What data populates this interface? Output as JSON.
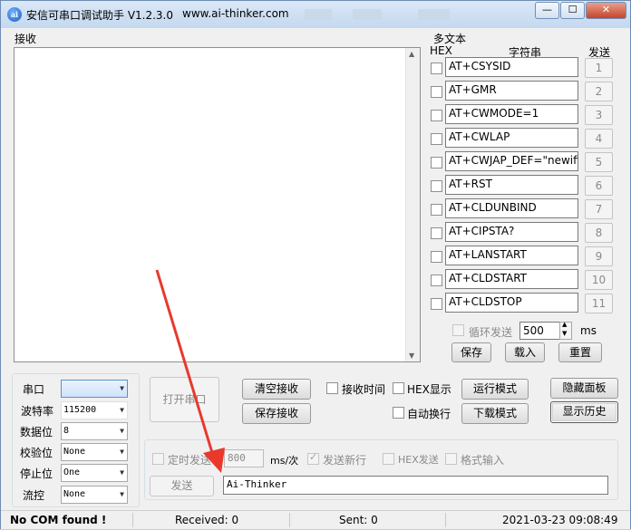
{
  "titlebar": {
    "title": "安信可串口调试助手 V1.2.3.0",
    "url": "www.ai-thinker.com",
    "minimize_glyph": "—",
    "maximize_glyph": "☐",
    "close_glyph": "✕"
  },
  "receive": {
    "label": "接收"
  },
  "multitext": {
    "label": "多文本",
    "col_hex": "HEX",
    "col_string": "字符串",
    "col_send": "发送",
    "rows": [
      {
        "text": "AT+CSYSID",
        "num": "1"
      },
      {
        "text": "AT+GMR",
        "num": "2"
      },
      {
        "text": "AT+CWMODE=1",
        "num": "3"
      },
      {
        "text": "AT+CWLAP",
        "num": "4"
      },
      {
        "text": "AT+CWJAP_DEF=\"newifi_",
        "num": "5"
      },
      {
        "text": "AT+RST",
        "num": "6"
      },
      {
        "text": "AT+CLDUNBIND",
        "num": "7"
      },
      {
        "text": "AT+CIPSTA?",
        "num": "8"
      },
      {
        "text": "AT+LANSTART",
        "num": "9"
      },
      {
        "text": "AT+CLDSTART",
        "num": "10"
      },
      {
        "text": "AT+CLDSTOP",
        "num": "11"
      }
    ],
    "loop_label": "循环发送",
    "loop_value": "500",
    "loop_unit": "ms",
    "save": "保存",
    "load": "载入",
    "reset": "重置"
  },
  "serial": {
    "port_label": "串口",
    "port_value": "",
    "baud_label": "波特率",
    "baud_value": "115200",
    "databits_label": "数据位",
    "databits_value": "8",
    "parity_label": "校验位",
    "parity_value": "None",
    "stopbits_label": "停止位",
    "stopbits_value": "One",
    "flow_label": "流控",
    "flow_value": "None",
    "open_button": "打开串口"
  },
  "controls": {
    "clear_recv": "清空接收",
    "save_recv": "保存接收",
    "recv_time": "接收时间",
    "hex_display": "HEX显示",
    "auto_wrap": "自动换行",
    "run_mode": "运行模式",
    "download_mode": "下载模式",
    "hide_panel": "隐藏面板",
    "show_history": "显示历史"
  },
  "send": {
    "timed_send": "定时发送",
    "interval_value": "800",
    "interval_unit": "ms/次",
    "send_newline": "发送新行",
    "hex_send": "HEX发送",
    "format_input": "格式输入",
    "send_button": "发送",
    "send_text": "Ai-Thinker"
  },
  "status": {
    "com": "No COM found !",
    "received": "Received: 0",
    "sent": "Sent: 0",
    "datetime": "2021-03-23 09:08:49"
  },
  "colors": {
    "annotation_arrow": "#e8392c",
    "titlebar": "#c4d8ef"
  }
}
